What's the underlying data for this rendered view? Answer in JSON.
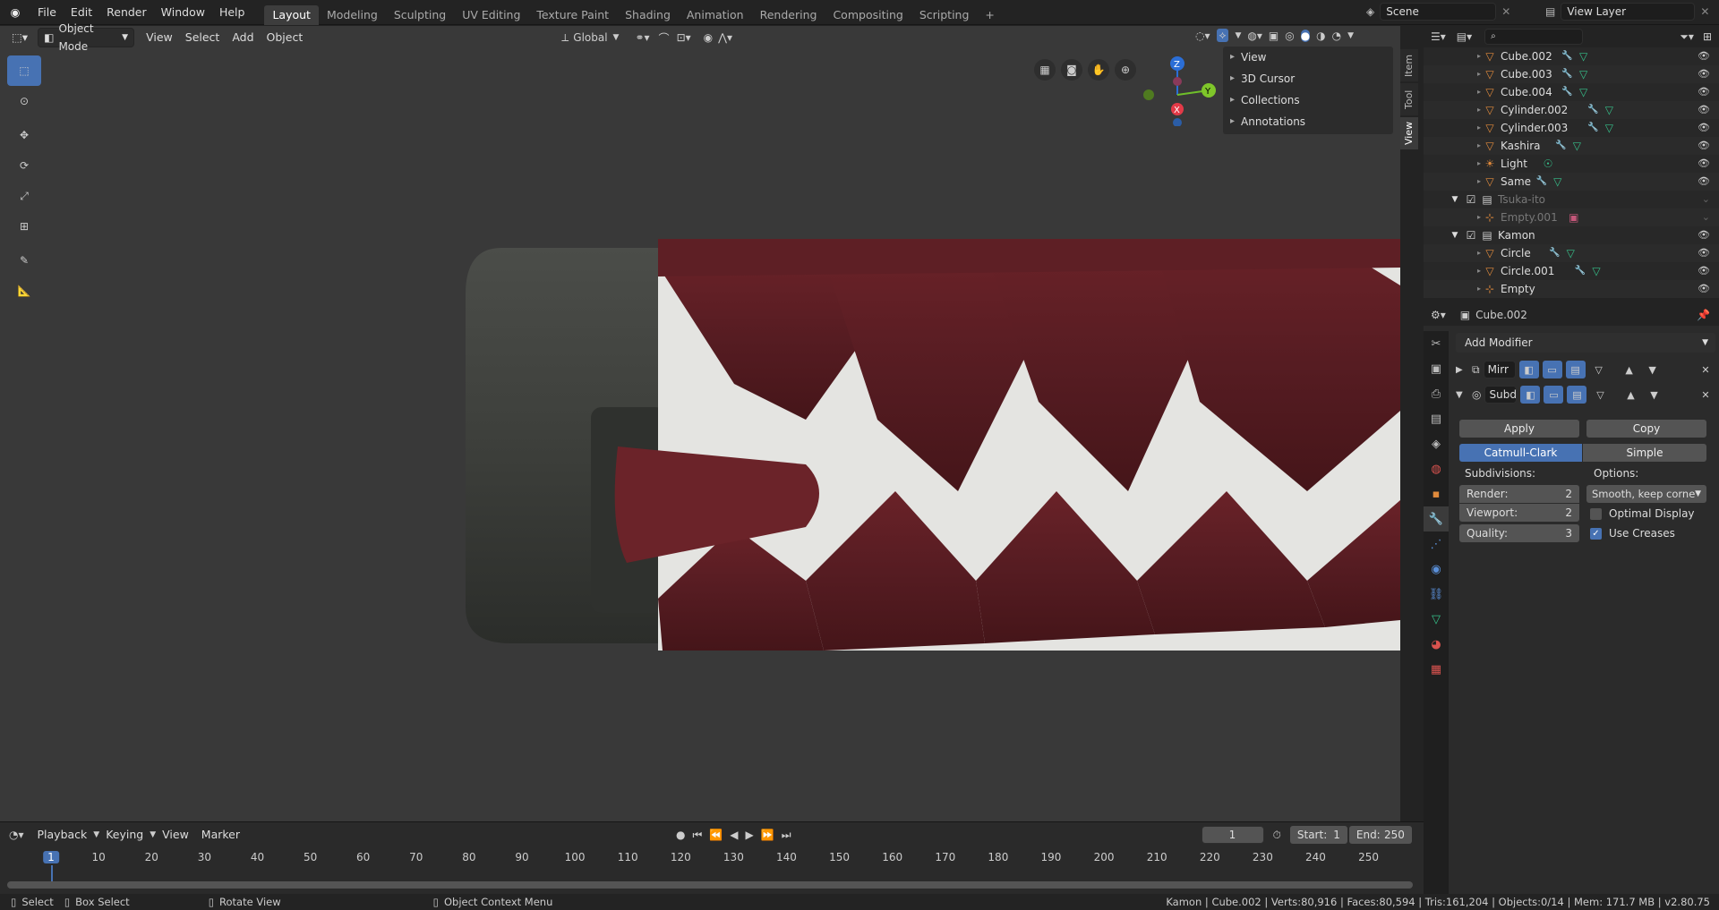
{
  "topbar": {
    "menus": [
      "File",
      "Edit",
      "Render",
      "Window",
      "Help"
    ],
    "workspaces": [
      "Layout",
      "Modeling",
      "Sculpting",
      "UV Editing",
      "Texture Paint",
      "Shading",
      "Animation",
      "Rendering",
      "Compositing",
      "Scripting"
    ],
    "add_tab": "+",
    "scene": "Scene",
    "view_layer": "View Layer"
  },
  "viewport": {
    "mode": "Object Mode",
    "menus": [
      "View",
      "Select",
      "Add",
      "Object"
    ],
    "orientation": "Global",
    "npanel": [
      "View",
      "3D Cursor",
      "Collections",
      "Annotations"
    ],
    "ntabs": [
      "Item",
      "Tool",
      "View"
    ],
    "gizmo": {
      "z": "Z",
      "y": "Y",
      "x": "X"
    }
  },
  "outliner": {
    "search_placeholder": "",
    "rows": [
      {
        "name": "Cube.002",
        "type": "mesh",
        "indent": 2
      },
      {
        "name": "Cube.003",
        "type": "mesh",
        "indent": 2
      },
      {
        "name": "Cube.004",
        "type": "mesh",
        "indent": 2
      },
      {
        "name": "Cylinder.002",
        "type": "mesh",
        "indent": 2
      },
      {
        "name": "Cylinder.003",
        "type": "mesh",
        "indent": 2
      },
      {
        "name": "Kashira",
        "type": "mesh",
        "indent": 2
      },
      {
        "name": "Light",
        "type": "light",
        "indent": 2
      },
      {
        "name": "Same",
        "type": "mesh",
        "indent": 2
      },
      {
        "name": "Tsuka-ito",
        "type": "collection",
        "indent": 1,
        "disabled": true
      },
      {
        "name": "Empty.001",
        "type": "empty",
        "indent": 2,
        "disabled": true
      },
      {
        "name": "Kamon",
        "type": "collection",
        "indent": 1
      },
      {
        "name": "Circle",
        "type": "mesh",
        "indent": 2
      },
      {
        "name": "Circle.001",
        "type": "mesh",
        "indent": 2
      },
      {
        "name": "Empty",
        "type": "empty",
        "indent": 2
      }
    ]
  },
  "properties": {
    "object": "Cube.002",
    "add_modifier": "Add Modifier",
    "modifiers": [
      {
        "name": "Mirr"
      },
      {
        "name": "Subd"
      }
    ],
    "apply": "Apply",
    "copy": "Copy",
    "catmull": "Catmull-Clark",
    "simple": "Simple",
    "subdivisions_label": "Subdivisions:",
    "options_label": "Options:",
    "render_label": "Render:",
    "render_value": "2",
    "viewport_label": "Viewport:",
    "viewport_value": "2",
    "quality_label": "Quality:",
    "quality_value": "3",
    "uv_smooth": "Smooth, keep corners",
    "optimal_display": "Optimal Display",
    "use_creases": "Use Creases"
  },
  "timeline": {
    "menus": [
      "Playback",
      "Keying",
      "View",
      "Marker"
    ],
    "current_frame": "1",
    "start_label": "Start:",
    "start": "1",
    "end_label": "End:",
    "end": "250",
    "ticks": [
      "1",
      "10",
      "20",
      "30",
      "40",
      "50",
      "60",
      "70",
      "80",
      "90",
      "100",
      "110",
      "120",
      "130",
      "140",
      "150",
      "160",
      "170",
      "180",
      "190",
      "200",
      "210",
      "220",
      "230",
      "240",
      "250"
    ]
  },
  "status": {
    "select": "Select",
    "box_select": "Box Select",
    "rotate_view": "Rotate View",
    "context_menu": "Object Context Menu",
    "info": "Kamon | Cube.002 | Verts:80,916 | Faces:80,594 | Tris:161,204 | Objects:0/14 | Mem: 171.7 MB | v2.80.75"
  },
  "colors": {
    "accent": "#4772b3",
    "wrap": "#5a1c22",
    "tsuka": "#e6e6e3",
    "kashira": "#3a3c38"
  }
}
